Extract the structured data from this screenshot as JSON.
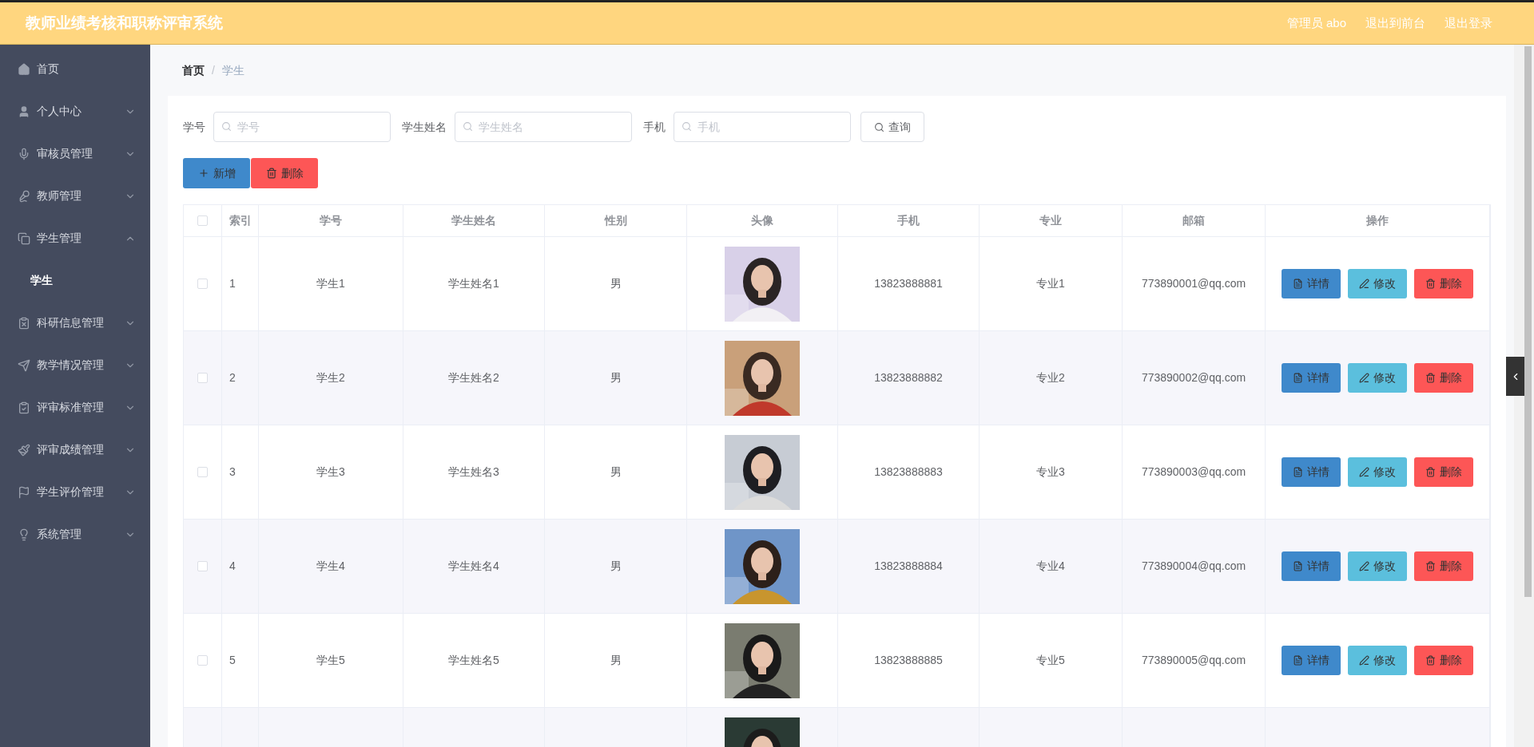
{
  "header": {
    "title": "教师业绩考核和职称评审系统",
    "links": [
      "管理员 abo",
      "退出到前台",
      "退出登录"
    ]
  },
  "sidebar": {
    "items": [
      {
        "label": "首页",
        "kind": "link"
      },
      {
        "label": "个人中心",
        "kind": "menu",
        "expanded": false
      },
      {
        "label": "审核员管理",
        "kind": "menu",
        "expanded": false
      },
      {
        "label": "教师管理",
        "kind": "menu",
        "expanded": false
      },
      {
        "label": "学生管理",
        "kind": "menu",
        "expanded": true,
        "children": [
          {
            "label": "学生",
            "selected": true
          }
        ]
      },
      {
        "label": "科研信息管理",
        "kind": "menu",
        "expanded": false
      },
      {
        "label": "教学情况管理",
        "kind": "menu",
        "expanded": false
      },
      {
        "label": "评审标准管理",
        "kind": "menu",
        "expanded": false
      },
      {
        "label": "评审成绩管理",
        "kind": "menu",
        "expanded": false
      },
      {
        "label": "学生评价管理",
        "kind": "menu",
        "expanded": false
      },
      {
        "label": "系统管理",
        "kind": "menu",
        "expanded": false
      }
    ]
  },
  "breadcrumb": {
    "items": [
      "首页",
      "学生"
    ],
    "separator": "/"
  },
  "search": {
    "fields": [
      {
        "label": "学号",
        "placeholder": "学号"
      },
      {
        "label": "学生姓名",
        "placeholder": "学生姓名"
      },
      {
        "label": "手机",
        "placeholder": "手机"
      }
    ],
    "button": "查询"
  },
  "actions": {
    "add": "新增",
    "delete": "删除"
  },
  "table": {
    "all_checked": false,
    "columns": [
      "索引",
      "学号",
      "学生姓名",
      "性别",
      "头像",
      "手机",
      "专业",
      "邮箱",
      "操作"
    ],
    "rows": [
      {
        "kind": "full",
        "checked": false,
        "cells": [
          "1",
          "学生1",
          "学生姓名1",
          "男",
          "13823888881",
          "专业1",
          "773890001@qq.com"
        ],
        "actions": [
          "详情",
          "修改",
          "删除"
        ]
      },
      {
        "kind": "full",
        "checked": false,
        "cells": [
          "2",
          "学生2",
          "学生姓名2",
          "男",
          "13823888882",
          "专业2",
          "773890002@qq.com"
        ],
        "actions": [
          "详情",
          "修改",
          "删除"
        ]
      },
      {
        "kind": "full",
        "checked": false,
        "cells": [
          "3",
          "学生3",
          "学生姓名3",
          "男",
          "13823888883",
          "专业3",
          "773890003@qq.com"
        ],
        "actions": [
          "详情",
          "修改",
          "删除"
        ]
      },
      {
        "kind": "full",
        "checked": false,
        "cells": [
          "4",
          "学生4",
          "学生姓名4",
          "男",
          "13823888884",
          "专业4",
          "773890004@qq.com"
        ],
        "actions": [
          "详情",
          "修改",
          "删除"
        ]
      },
      {
        "kind": "full",
        "checked": false,
        "cells": [
          "5",
          "学生5",
          "学生姓名5",
          "男",
          "13823888885",
          "专业5",
          "773890005@qq.com"
        ],
        "actions": [
          "详情",
          "修改",
          "删除"
        ]
      },
      {
        "kind": "partial"
      }
    ]
  }
}
